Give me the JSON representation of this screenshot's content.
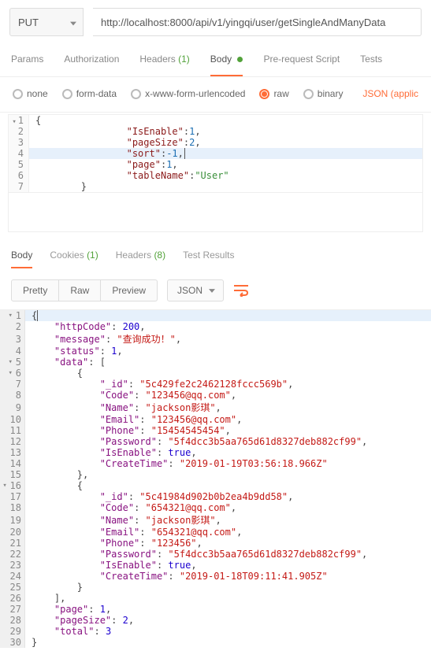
{
  "request": {
    "method": "PUT",
    "url": "http://localhost:8000/api/v1/yingqi/user/getSingleAndManyData"
  },
  "tabs": {
    "params": "Params",
    "auth": "Authorization",
    "headers": "Headers",
    "headers_count": "(1)",
    "body": "Body",
    "prereq": "Pre-request Script",
    "tests": "Tests"
  },
  "bodyTypes": {
    "none": "none",
    "form": "form-data",
    "xwww": "x-www-form-urlencoded",
    "raw": "raw",
    "binary": "binary",
    "jsonapp": "JSON (applic"
  },
  "reqBody": {
    "l1": "{",
    "l2a": "\"IsEnable\"",
    "l2b": ":",
    "l2c": "1",
    "l2d": ",",
    "l3a": "\"pageSize\"",
    "l3b": ":",
    "l3c": "2",
    "l3d": ",",
    "l4a": "\"sort\"",
    "l4b": ":",
    "l4c": "-1",
    "l4d": ",",
    "l5a": "\"page\"",
    "l5b": ":",
    "l5c": "1",
    "l5d": ",",
    "l6a": "\"tableName\"",
    "l6b": ":",
    "l6c": "\"User\"",
    "l7": "}"
  },
  "respTabs": {
    "body": "Body",
    "cookies": "Cookies",
    "cookies_count": "(1)",
    "headers": "Headers",
    "headers_count": "(8)",
    "tests": "Test Results"
  },
  "viewBar": {
    "pretty": "Pretty",
    "raw": "Raw",
    "preview": "Preview",
    "fmt": "JSON"
  },
  "resp": {
    "l1": "{",
    "k_httpCode": "\"httpCode\"",
    "v_httpCode": "200",
    "k_message": "\"message\"",
    "v_message": "\"查询成功！\"",
    "k_status": "\"status\"",
    "v_status": "1",
    "k_data": "\"data\"",
    "k_id": "\"_id\"",
    "k_code": "\"Code\"",
    "k_name": "\"Name\"",
    "k_email": "\"Email\"",
    "k_phone": "\"Phone\"",
    "k_pwd": "\"Password\"",
    "k_enable": "\"IsEnable\"",
    "k_ctime": "\"CreateTime\"",
    "d0_id": "\"5c429fe2c2462128fccc569b\"",
    "d0_code": "\"123456@qq.com\"",
    "d0_name": "\"jackson影琪\"",
    "d0_email": "\"123456@qq.com\"",
    "d0_phone": "\"15454545454\"",
    "d0_pwd": "\"5f4dcc3b5aa765d61d8327deb882cf99\"",
    "d0_enable": "true",
    "d0_ctime": "\"2019-01-19T03:56:18.966Z\"",
    "d1_id": "\"5c41984d902b0b2ea4b9dd58\"",
    "d1_code": "\"654321@qq.com\"",
    "d1_name": "\"jackson影琪\"",
    "d1_email": "\"654321@qq.com\"",
    "d1_phone": "\"123456\"",
    "d1_pwd": "\"5f4dcc3b5aa765d61d8327deb882cf99\"",
    "d1_enable": "true",
    "d1_ctime": "\"2019-01-18T09:11:41.905Z\"",
    "k_page": "\"page\"",
    "v_page": "1",
    "k_pageSize": "\"pageSize\"",
    "v_pageSize": "2",
    "k_total": "\"total\"",
    "v_total": "3"
  }
}
